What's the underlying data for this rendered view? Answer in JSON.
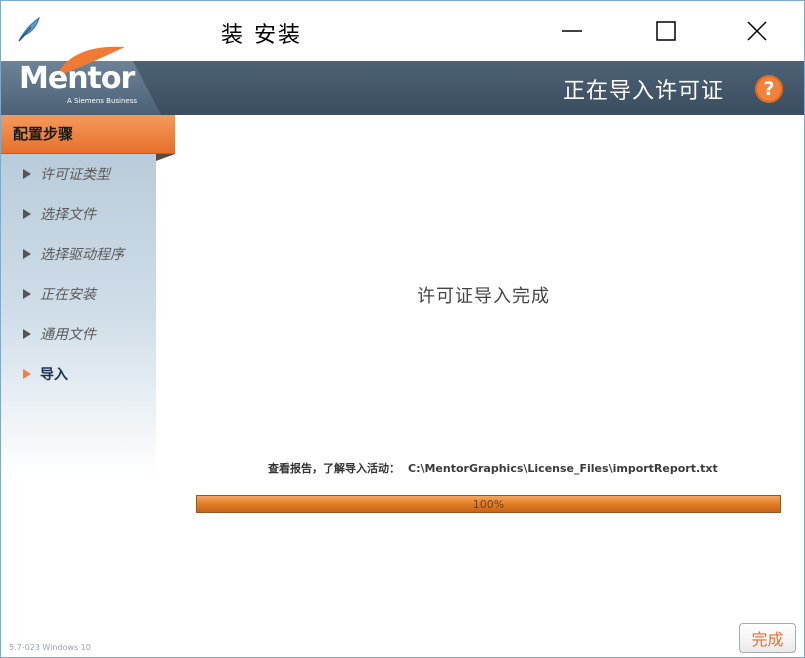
{
  "window": {
    "title": "装 安装",
    "controls": {
      "minimize": "minimize-icon",
      "maximize": "maximize-icon",
      "close": "close-icon"
    }
  },
  "header": {
    "logo_text": "Mentor",
    "logo_subtitle": "A Siemens Business",
    "title": "正在导入许可证",
    "help_label": "?"
  },
  "sidebar": {
    "header": "配置步骤",
    "steps": [
      {
        "label": "许可证类型",
        "active": false
      },
      {
        "label": "选择文件",
        "active": false
      },
      {
        "label": "选择驱动程序",
        "active": false
      },
      {
        "label": "正在安装",
        "active": false
      },
      {
        "label": "通用文件",
        "active": false
      },
      {
        "label": "导入",
        "active": true
      }
    ]
  },
  "main": {
    "status": "许可证导入完成",
    "report_label": "查看报告，了解导入活动：",
    "report_path": "C:\\MentorGraphics\\License_Files\\importReport.txt",
    "progress_percent": 100,
    "progress_label": "100%"
  },
  "footer": {
    "version": "5.7-023   Windows 10",
    "finish_label": "完成"
  },
  "colors": {
    "accent": "#e8702c",
    "header_bg": "#435668",
    "sidebar_bg": "#c4d4e1"
  }
}
